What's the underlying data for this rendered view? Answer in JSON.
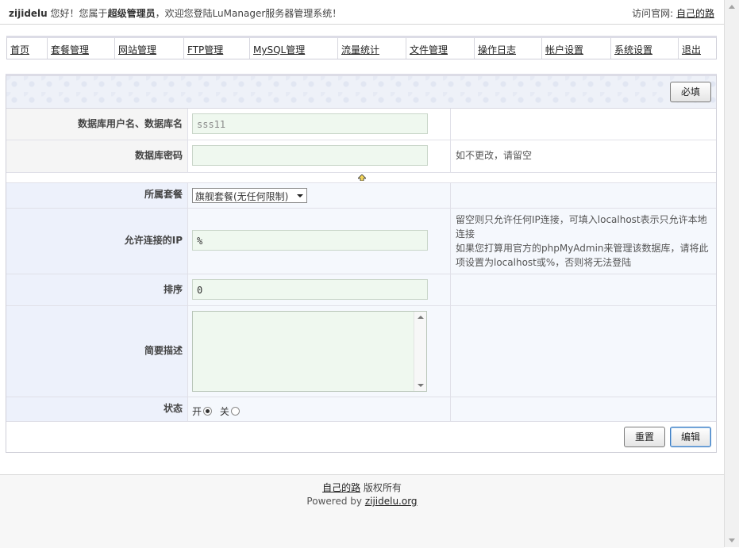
{
  "header": {
    "username": "zijidelu",
    "greeting_pre": "您好！您属于",
    "role": "超级管理员",
    "greeting_post": "，欢迎您登陆LuManager服务器管理系统！",
    "visit_label": "访问官网:",
    "visit_link": "自己的路"
  },
  "nav": [
    {
      "label": "首页"
    },
    {
      "label": "套餐管理"
    },
    {
      "label": "网站管理"
    },
    {
      "label": "FTP管理"
    },
    {
      "label": "MySQL管理"
    },
    {
      "label": "流量统计"
    },
    {
      "label": "文件管理"
    },
    {
      "label": "操作日志"
    },
    {
      "label": "帐户设置"
    },
    {
      "label": "系统设置"
    },
    {
      "label": "退出"
    }
  ],
  "form": {
    "required_button": "必填",
    "db_user_label": "数据库用户名、数据库名",
    "db_user_value": "sss11",
    "db_pass_label": "数据库密码",
    "db_pass_value": "",
    "db_pass_hint": "如不更改，请留空",
    "package_label": "所属套餐",
    "package_value": "旗舰套餐(无任何限制)",
    "ip_label": "允许连接的IP",
    "ip_value": "%",
    "ip_hint_1": "留空则只允许任何IP连接，可填入localhost表示只允许本地连接",
    "ip_hint_2": "如果您打算用官方的phpMyAdmin来管理该数据库，请将此项设置为localhost或%，否则将无法登陆",
    "sort_label": "排序",
    "sort_value": "0",
    "desc_label": "简要描述",
    "desc_value": "",
    "status_label": "状态",
    "status_on": "开",
    "status_off": "关",
    "reset_button": "重置",
    "edit_button": "编辑"
  },
  "footer": {
    "site_link": "自己的路",
    "rights": "版权所有",
    "powered_by": "Powered by",
    "powered_link": "zijidelu.org"
  }
}
